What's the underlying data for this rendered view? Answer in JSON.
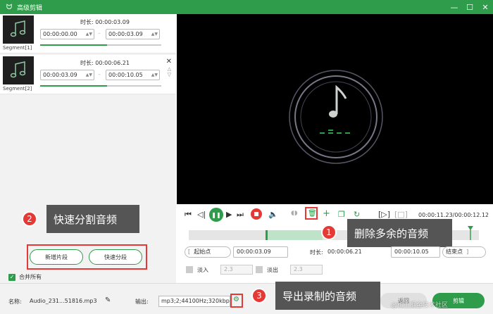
{
  "window": {
    "title": "高级剪辑",
    "controls": [
      "—",
      "☐",
      "✕"
    ]
  },
  "segments": [
    {
      "name": "Segment[1]",
      "duration_label": "时长:",
      "duration": "00:00:03.09",
      "start": "00:00:00.00",
      "end": "00:00:03.09",
      "progress": 0.55
    },
    {
      "name": "Segment[2]",
      "duration_label": "时长:",
      "duration": "00:00:06.21",
      "start": "00:00:03.09",
      "end": "00:00:10.05",
      "progress": 0.55
    }
  ],
  "callouts": [
    {
      "num": "1",
      "text": "删除多余的音频"
    },
    {
      "num": "2",
      "text": "快速分割音频"
    },
    {
      "num": "3",
      "text": "导出录制的音频"
    }
  ],
  "left_buttons": {
    "new_segment": "新增片段",
    "quick_split": "快速分段"
  },
  "merge_all": "合并所有",
  "player": {
    "time_display": "00:00:11.23/00:00:12.12",
    "start_label": "起始点",
    "start_value": "00:00:03.09",
    "duration_label": "时长:",
    "duration_value": "00:00:06.21",
    "end_value": "00:00:10.05",
    "end_label": "结束点",
    "fade_in_label": "淡入",
    "fade_in_value": "2.3",
    "fade_out_label": "淡出",
    "fade_out_value": "2.3"
  },
  "footer": {
    "name_label": "名称:",
    "file_name": "Audio_231...51816.mp3",
    "output_label": "输出:",
    "output_value": "mp3;2;44100Hz;320kbps",
    "back_button": "返回",
    "cut_button": "剪辑",
    "watermark": "@稀土掘金技术社区"
  },
  "colors": {
    "brand": "#2e9c4a",
    "callout_red": "#e53935",
    "callout_bg": "#555555"
  }
}
